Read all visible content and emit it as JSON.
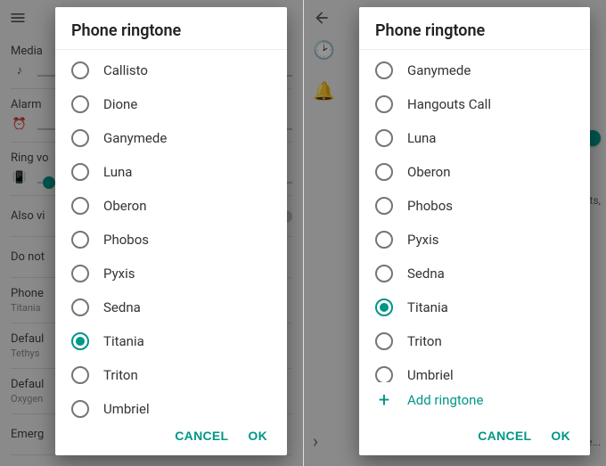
{
  "left": {
    "topbar_icon": "menu",
    "bg_rows": {
      "media": "Media",
      "alarm": "Alarm",
      "ring": "Ring vo",
      "also": "Also vi",
      "donot": "Do not",
      "phone": "Phone",
      "phone_sub": "Titania",
      "default1": "Defaul",
      "default1_sub": "Tethys",
      "default2": "Defaul",
      "default2_sub": "Oxygen",
      "emerg": "Emerg"
    },
    "dialog_title": "Phone ringtone",
    "options": [
      "Callisto",
      "Dione",
      "Ganymede",
      "Luna",
      "Oberon",
      "Phobos",
      "Pyxis",
      "Sedna",
      "Titania",
      "Triton",
      "Umbriel"
    ],
    "selected": "Titania",
    "cancel": "CANCEL",
    "ok": "OK"
  },
  "right": {
    "dialog_title": "Phone ringtone",
    "options": [
      "Ganymede",
      "Hangouts Call",
      "Luna",
      "Oberon",
      "Phobos",
      "Pyxis",
      "Sedna",
      "Titania",
      "Triton",
      "Umbriel"
    ],
    "selected": "Titania",
    "add_label": "Add ringtone",
    "cancel": "CANCEL",
    "ok": "OK",
    "peek_text1": "ts,",
    "peek_text2": "Scree..."
  },
  "colors": {
    "accent": "#009688"
  }
}
